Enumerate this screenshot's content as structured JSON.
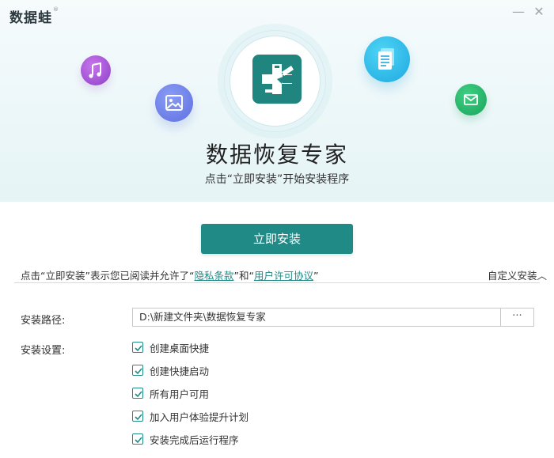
{
  "app": {
    "logo_text": "数据蛙",
    "logo_mark": "®"
  },
  "window": {
    "minimize_glyph": "—",
    "close_glyph": "✕"
  },
  "hero": {
    "title": "数据恢复专家",
    "subtitle": "点击“立即安装”开始安装程序",
    "icons": [
      "music-icon",
      "image-icon",
      "document-icon",
      "mail-icon"
    ]
  },
  "install": {
    "button_label": "立即安装"
  },
  "agreement": {
    "prefix": "点击“立即安装”表示您已阅读并允许了",
    "quote_open": "“",
    "privacy_link": "隐私条款",
    "quote_close": "”",
    "and_text": "和",
    "license_link": "用户许可协议",
    "custom_label": "自定义安装",
    "custom_chevron": "︿"
  },
  "settings": {
    "path_label": "安装路径:",
    "path_value": "D:\\新建文件夹\\数据恢复专家",
    "browse_label": "···",
    "options_label": "安装设置:",
    "options": [
      {
        "label": "创建桌面快捷",
        "checked": true
      },
      {
        "label": "创建快捷启动",
        "checked": true
      },
      {
        "label": "所有用户可用",
        "checked": true
      },
      {
        "label": "加入用户体验提升计划",
        "checked": true
      },
      {
        "label": "安装完成后运行程序",
        "checked": true
      }
    ]
  },
  "colors": {
    "accent": "#1f8a86",
    "hero_bg": "#eaf6f8"
  }
}
